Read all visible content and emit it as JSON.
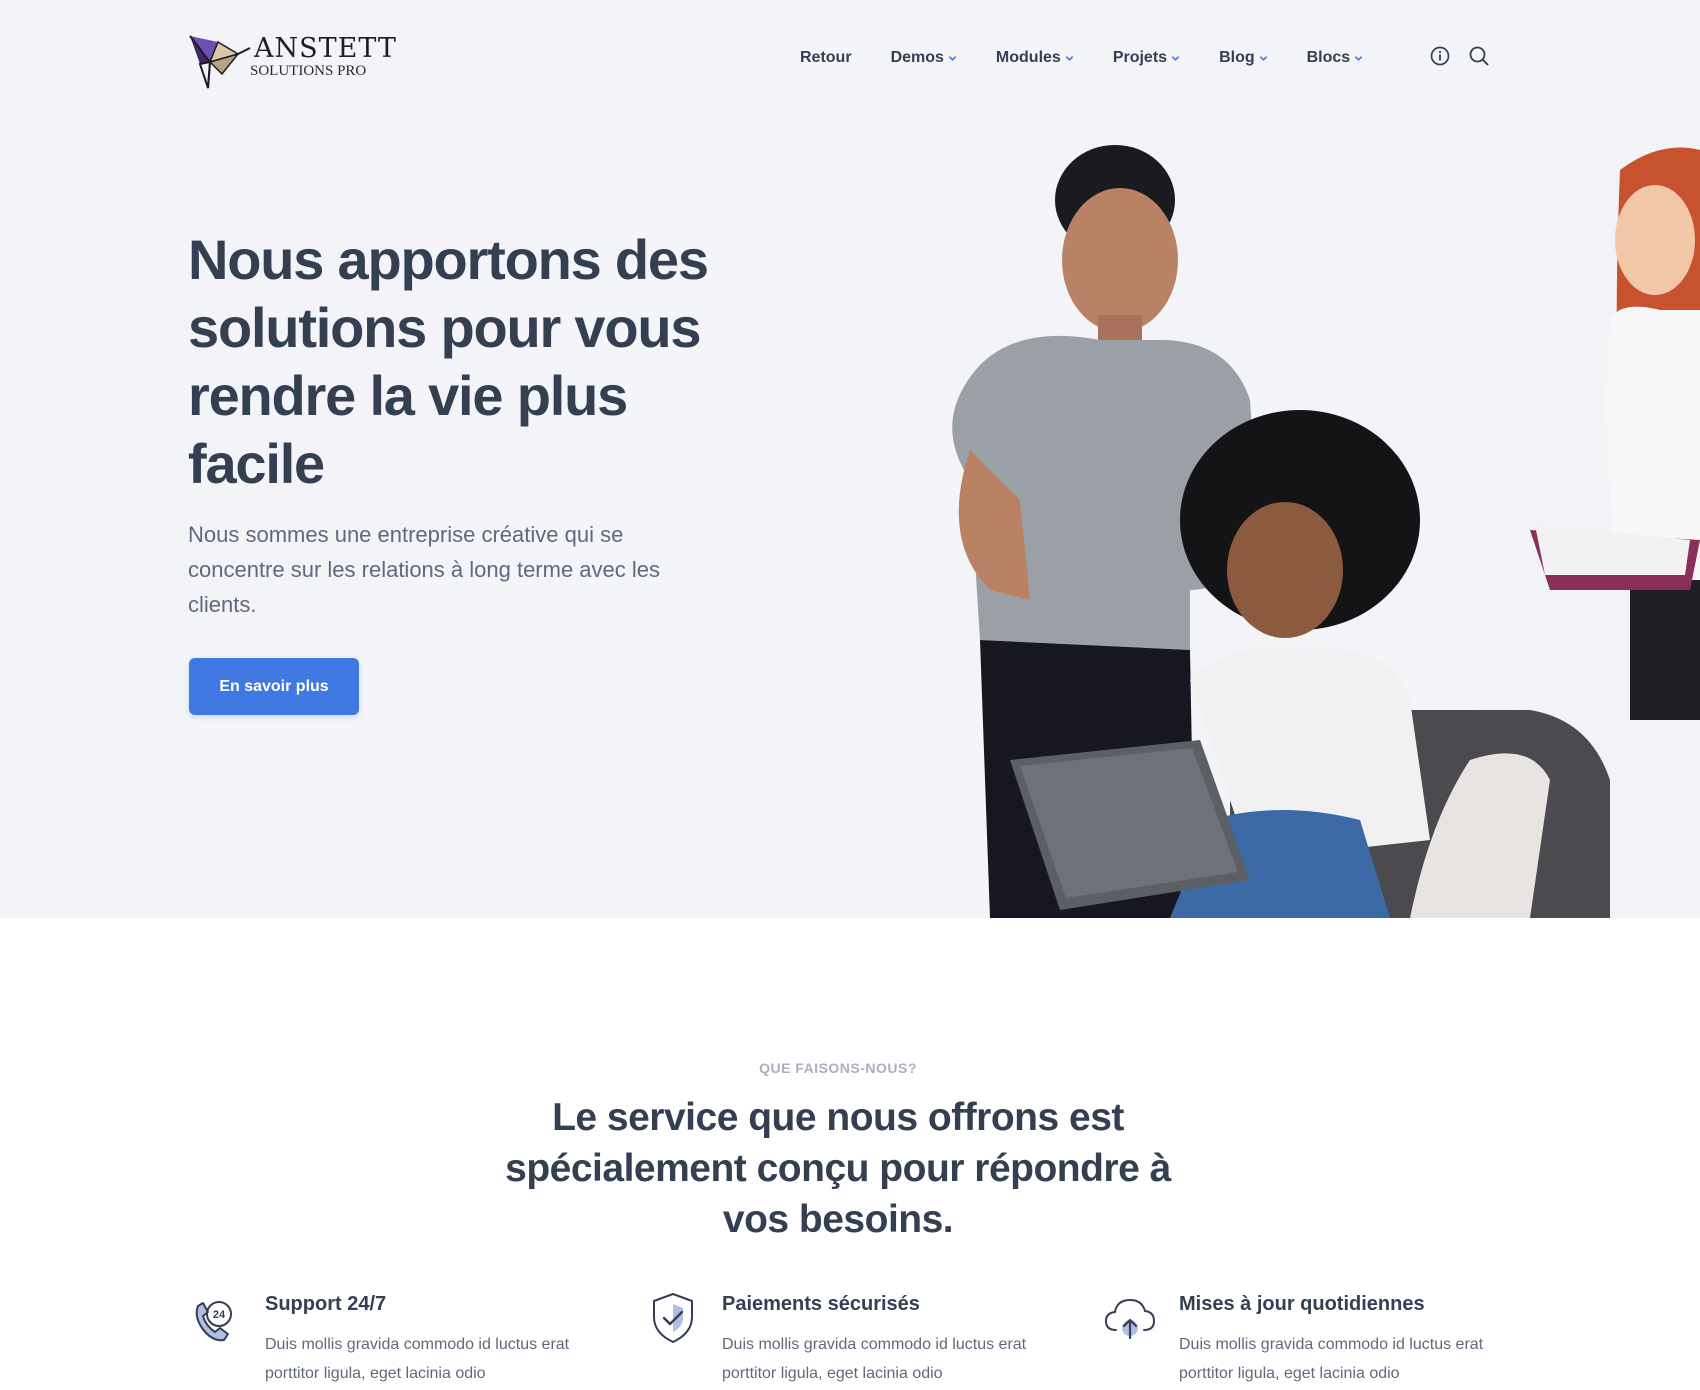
{
  "header": {
    "logo_name": "ANSTETT",
    "logo_sub": "SOLUTIONS PRO",
    "nav": [
      {
        "label": "Retour",
        "dropdown": false
      },
      {
        "label": "Demos",
        "dropdown": true
      },
      {
        "label": "Modules",
        "dropdown": true
      },
      {
        "label": "Projets",
        "dropdown": true
      },
      {
        "label": "Blog",
        "dropdown": true
      },
      {
        "label": "Blocs",
        "dropdown": true
      }
    ],
    "icons": [
      "info-icon",
      "search-icon"
    ]
  },
  "hero": {
    "title": "Nous apportons des solutions pour vous rendre la vie plus facile",
    "subtitle": "Nous sommes une entreprise créative qui se concentre sur les relations à long terme avec les clients.",
    "button_label": "En savoir plus"
  },
  "services": {
    "eyebrow": "QUE FAISONS-NOUS?",
    "title": "Le service que nous offrons est spécialement conçu pour répondre à vos besoins.",
    "features": [
      {
        "icon": "phone-24-icon",
        "title": "Support 24/7",
        "text": "Duis mollis gravida commodo id luctus erat porttitor ligula, eget lacinia odio"
      },
      {
        "icon": "shield-check-icon",
        "title": "Paiements sécurisés",
        "text": "Duis mollis gravida commodo id luctus erat porttitor ligula, eget lacinia odio"
      },
      {
        "icon": "cloud-upload-icon",
        "title": "Mises à jour quotidiennes",
        "text": "Duis mollis gravida commodo id luctus erat porttitor ligula, eget lacinia odio"
      }
    ]
  },
  "colors": {
    "primary": "#3f78e0",
    "heading": "#343f52",
    "body_text": "#60697b",
    "eyebrow": "#aab0bc",
    "hero_bg": "#f3f4f8"
  }
}
